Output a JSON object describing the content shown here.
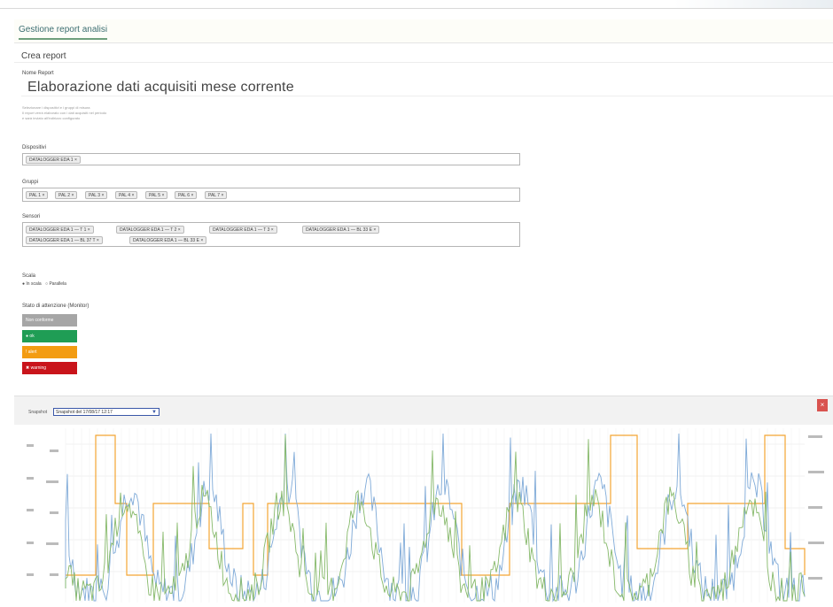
{
  "header": {
    "tab_label": "Gestione report analisi"
  },
  "section": {
    "title": "Crea report"
  },
  "report_name": {
    "label": "Nome Report",
    "value": "Elaborazione dati acquisiti mese corrente"
  },
  "help_lines": [
    "Selezionare i dispositivi e i gruppi di misura",
    "Il report verrà elaborato con i dati acquisiti nel periodo",
    "e sarà inviato all'indirizzo configurato"
  ],
  "dispositivi": {
    "label": "Dispositivi",
    "chips": [
      "DATALOGGER EDA 1 ×"
    ]
  },
  "gruppi": {
    "label": "Gruppi",
    "chips": [
      "PAL 1 ×",
      "PAL 2 ×",
      "PAL 3 ×",
      "PAL 4 ×",
      "PAL 5 ×",
      "PAL 6 ×",
      "PAL 7 ×"
    ]
  },
  "sensori": {
    "label": "Sensori",
    "chips": [
      "DATALOGGER EDA 1 — T 1 ×",
      "DATALOGGER EDA 1 — T 2 ×",
      "DATALOGGER EDA 1 — T 3 ×",
      "DATALOGGER EDA 1 — BL 33 E ×",
      "DATALOGGER EDA 1 — BL 37 T ×",
      "DATALOGGER EDA 1 — BL 33 E ×"
    ]
  },
  "scala": {
    "label": "Scala",
    "options": [
      "● In scala",
      "○ Parallela"
    ]
  },
  "stato": {
    "label": "Stato di attenzione (Monitor)",
    "buttons": [
      {
        "label": "Non conforme",
        "color": "#a6a6a6"
      },
      {
        "label": "● ok",
        "color": "#1f9d55"
      },
      {
        "label": "! alert",
        "color": "#f39c12"
      },
      {
        "label": "✖ warning",
        "color": "#c9141b"
      }
    ]
  },
  "chart": {
    "label": "Snapshot",
    "select_value": "Snapshot del 17/08/17 12:17",
    "close_glyph": "×"
  },
  "colors": {
    "accent": "#6f9f7c",
    "series_blue": "#7faad8",
    "series_green": "#86b96a",
    "series_orange": "#f4a533"
  }
}
